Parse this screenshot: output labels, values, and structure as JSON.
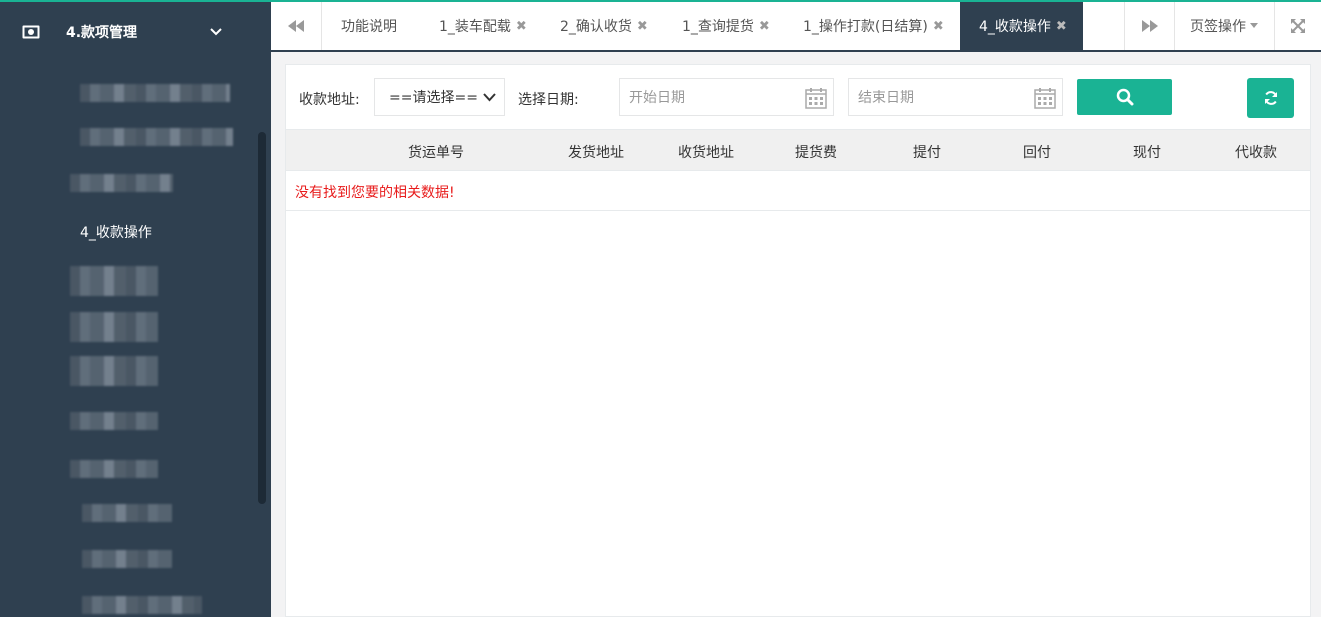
{
  "sidebar": {
    "section_title": "4.款项管理",
    "section_icon": "money-icon",
    "active_item": "4_收款操作"
  },
  "tabbar": {
    "tabs": [
      {
        "label": "功能说明",
        "closable": false,
        "active": false
      },
      {
        "label": "1_装车配载",
        "closable": true,
        "active": false
      },
      {
        "label": "2_确认收货",
        "closable": true,
        "active": false
      },
      {
        "label": "1_查询提货",
        "closable": true,
        "active": false
      },
      {
        "label": "1_操作打款(日结算)",
        "closable": true,
        "active": false
      },
      {
        "label": "4_收款操作",
        "closable": true,
        "active": true
      }
    ],
    "page_ops_label": "页签操作",
    "close_glyph": "✖"
  },
  "filters": {
    "address_label": "收款地址:",
    "address_select_value": "==请选择==",
    "date_label": "选择日期:",
    "start_date_placeholder": "开始日期",
    "end_date_placeholder": "结束日期"
  },
  "table": {
    "columns": [
      "货运单号",
      "发货地址",
      "收货地址",
      "提货费",
      "提付",
      "回付",
      "现付",
      "代收款"
    ],
    "empty_message": "没有找到您要的相关数据!"
  },
  "colors": {
    "accent": "#1ab394",
    "sidebar_bg": "#2f4050",
    "error_text": "#e81c1c"
  }
}
